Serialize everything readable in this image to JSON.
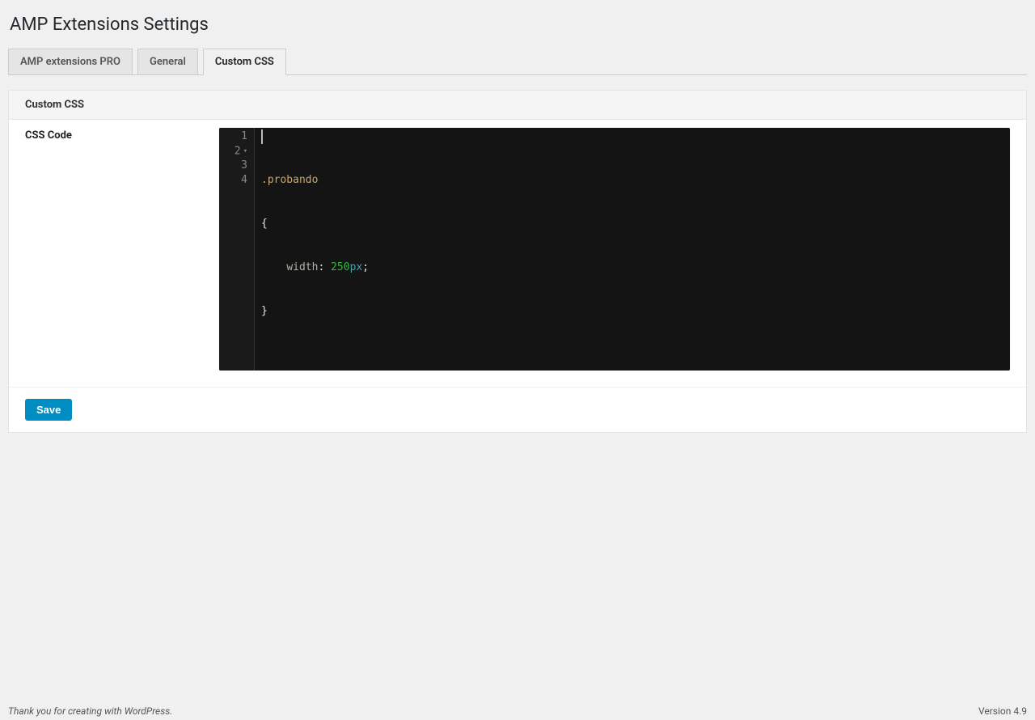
{
  "page": {
    "title": "AMP Extensions Settings"
  },
  "tabs": {
    "items": [
      {
        "label": "AMP extensions PRO"
      },
      {
        "label": "General"
      },
      {
        "label": "Custom CSS"
      }
    ]
  },
  "panel": {
    "header": "Custom CSS",
    "field_label": "CSS Code",
    "editor": {
      "line_numbers": [
        "1",
        "2",
        "3",
        "4"
      ],
      "code": {
        "selector": ".probando",
        "open_brace": "{",
        "indent": "    ",
        "property": "width",
        "colon": ": ",
        "value_num": "250",
        "value_unit": "px",
        "semicolon": ";",
        "close_brace": "}"
      }
    },
    "save_label": "Save"
  },
  "footer": {
    "left": "Thank you for creating with WordPress.",
    "right": "Version 4.9"
  }
}
